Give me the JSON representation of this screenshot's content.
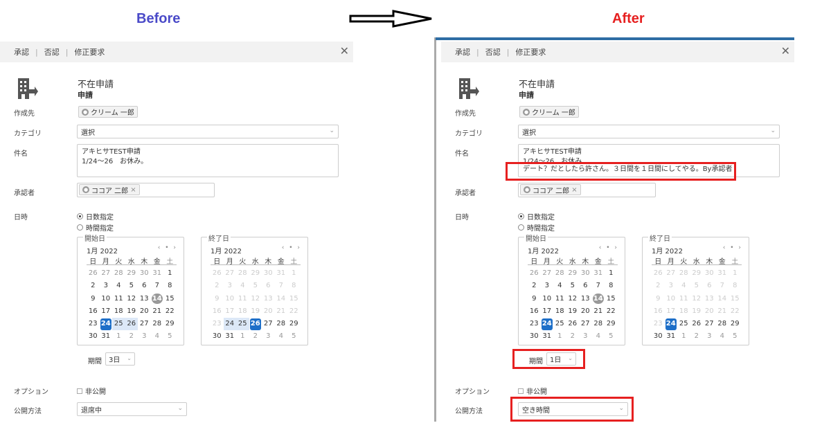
{
  "headings": {
    "before": "Before",
    "after": "After"
  },
  "toolbar": {
    "approve": "承認",
    "reject": "否認",
    "revise": "修正要求"
  },
  "form": {
    "title": "不在申請",
    "subtitle": "申請",
    "labels": {
      "created_by": "作成先",
      "category": "カテゴリ",
      "subject": "件名",
      "approver": "承認者",
      "datetime": "日時",
      "options": "オプション",
      "publish": "公開方法"
    },
    "creator_name": "クリーム 一郎",
    "category_value": "選択",
    "subject_line1": "アキヒサTEST申請",
    "subject_line2": "1/24〜26　お休み。",
    "approver_name": "ココア 二郎",
    "approver_remove": "×",
    "radio_days": "日数指定",
    "radio_time": "時間指定",
    "start_legend": "開始日",
    "end_legend": "終了日",
    "month": "1月 2022",
    "cal_nav": "‹ • ›",
    "weekdays": [
      "日",
      "月",
      "火",
      "水",
      "木",
      "金",
      "土"
    ],
    "period_label": "期間",
    "private_label": "非公開"
  },
  "before": {
    "period_value": "3日",
    "publish_value": "退席中"
  },
  "after": {
    "subject_line2": "1/24〜26　お休み",
    "subject_line3": "デート？だとしたら許さん。３日間を１日間にしてやる。By承認者",
    "period_value": "1日",
    "publish_value": "空き時間"
  }
}
